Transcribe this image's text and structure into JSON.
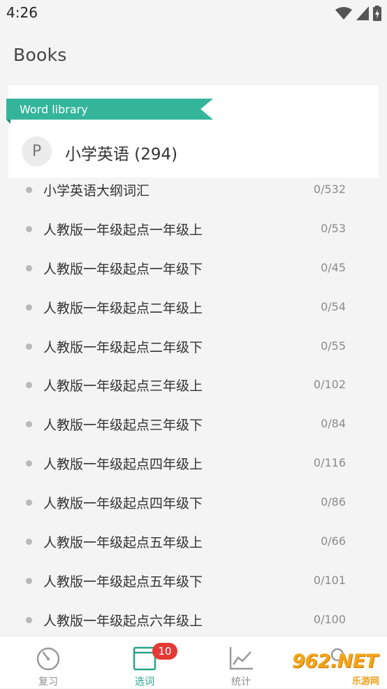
{
  "status_bar": {
    "time": "4:26"
  },
  "header": {
    "title": "Books"
  },
  "library": {
    "ribbon_label": "Word library",
    "avatar_letter": "P",
    "group_title": "小学英语 (294)"
  },
  "books": [
    {
      "name": "小学英语大纲词汇",
      "count": "0/532"
    },
    {
      "name": "人教版一年级起点一年级上",
      "count": "0/53"
    },
    {
      "name": "人教版一年级起点一年级下",
      "count": "0/45"
    },
    {
      "name": "人教版一年级起点二年级上",
      "count": "0/54"
    },
    {
      "name": "人教版一年级起点二年级下",
      "count": "0/55"
    },
    {
      "name": "人教版一年级起点三年级上",
      "count": "0/102"
    },
    {
      "name": "人教版一年级起点三年级下",
      "count": "0/84"
    },
    {
      "name": "人教版一年级起点四年级上",
      "count": "0/116"
    },
    {
      "name": "人教版一年级起点四年级下",
      "count": "0/86"
    },
    {
      "name": "人教版一年级起点五年级上",
      "count": "0/66"
    },
    {
      "name": "人教版一年级起点五年级下",
      "count": "0/101"
    },
    {
      "name": "人教版一年级起点六年级上",
      "count": "0/100"
    }
  ],
  "tabs": {
    "review": {
      "label": "复习",
      "icon": "dial-icon"
    },
    "select": {
      "label": "选词",
      "icon": "book-icon",
      "badge": "10"
    },
    "stats": {
      "label": "统计",
      "icon": "chart-icon"
    },
    "fourth": {
      "icon": "person-icon"
    }
  },
  "watermark": {
    "main": "962.NET",
    "sub": "乐游网"
  },
  "colors": {
    "accent": "#34b59a",
    "badge": "#e53935",
    "background": "#f4f4f4"
  }
}
